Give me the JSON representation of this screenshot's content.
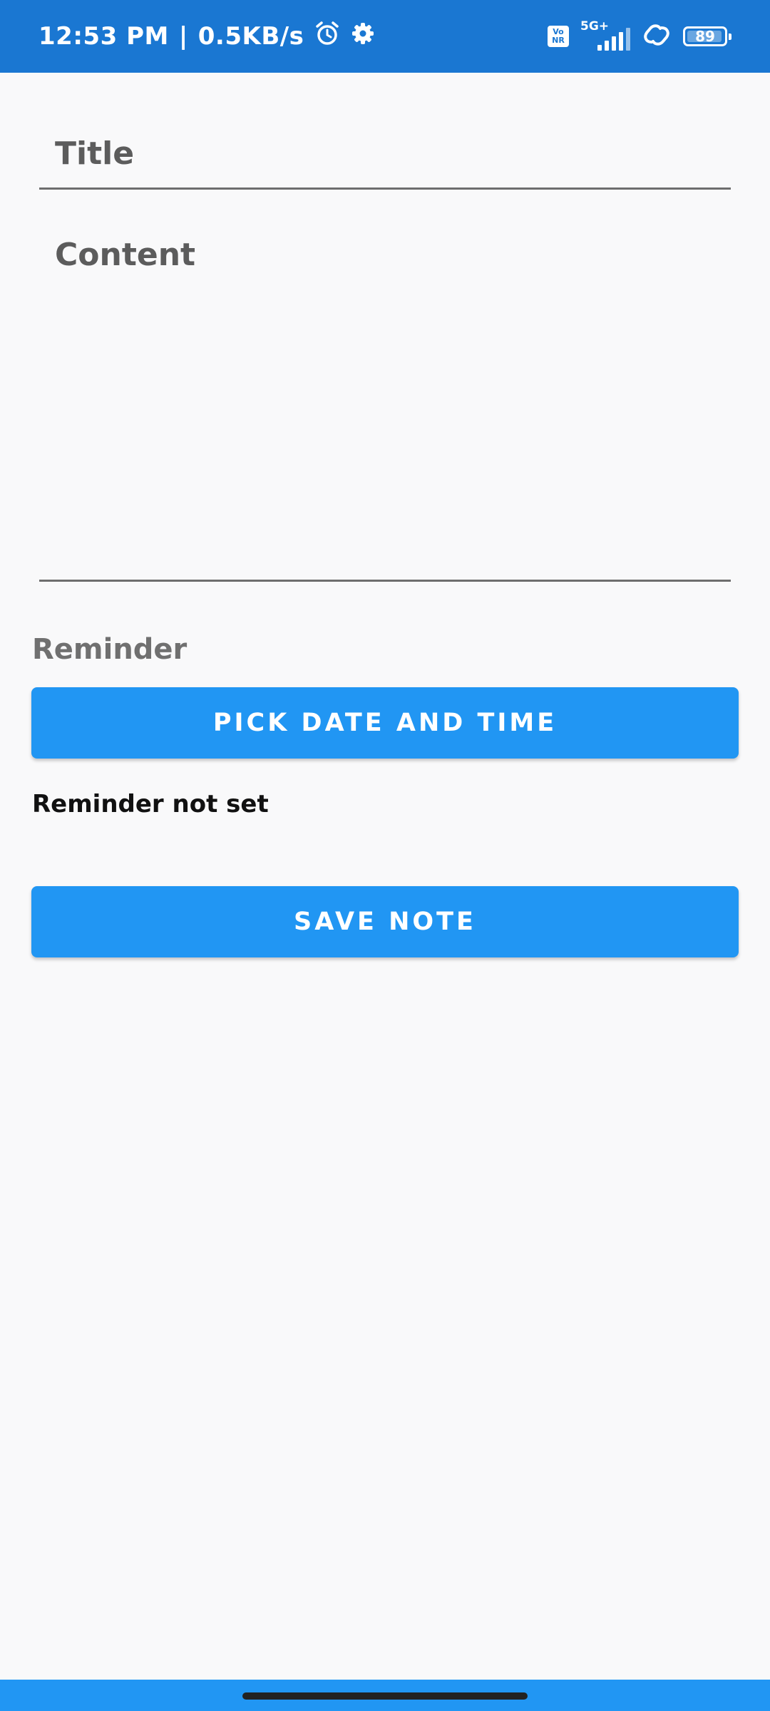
{
  "status_bar": {
    "time": "12:53 PM",
    "separator": "|",
    "net_speed": "0.5KB/s",
    "vonr_top": "Vo",
    "vonr_bottom": "NR",
    "network_type": "5G+",
    "battery_level": "89",
    "color": "#1a77d2"
  },
  "form": {
    "title_placeholder": "Title",
    "content_placeholder": "Content",
    "reminder_label": "Reminder",
    "pick_button_label": "PICK DATE AND TIME",
    "reminder_status": "Reminder not set",
    "save_button_label": "SAVE NOTE"
  },
  "colors": {
    "accent": "#2196f3",
    "background": "#f9f9fa"
  },
  "icons": [
    "alarm-icon",
    "settings-gear-icon",
    "vonr-icon",
    "signal-icon",
    "hotspot-link-icon",
    "battery-icon"
  ]
}
